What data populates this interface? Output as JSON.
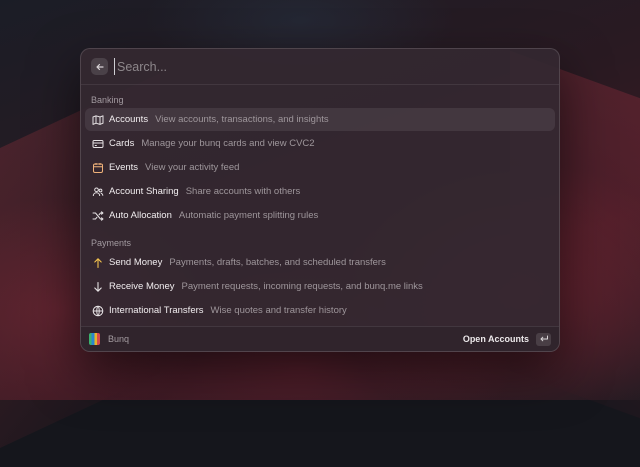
{
  "search": {
    "placeholder": "Search..."
  },
  "sections": [
    {
      "title": "Banking",
      "items": [
        {
          "label": "Accounts",
          "desc": "View accounts, transactions, and insights",
          "icon": "map-icon",
          "color": "#e6e2e4"
        },
        {
          "label": "Cards",
          "desc": "Manage your bunq cards and view CVC2",
          "icon": "card-icon",
          "color": "#e6e2e4"
        },
        {
          "label": "Events",
          "desc": "View your activity feed",
          "icon": "calendar-icon",
          "color": "#f0b27a"
        },
        {
          "label": "Account Sharing",
          "desc": "Share accounts with others",
          "icon": "users-icon",
          "color": "#e6e2e4"
        },
        {
          "label": "Auto Allocation",
          "desc": "Automatic payment splitting rules",
          "icon": "shuffle-icon",
          "color": "#e6e2e4"
        }
      ]
    },
    {
      "title": "Payments",
      "items": [
        {
          "label": "Send Money",
          "desc": "Payments, drafts, batches, and scheduled transfers",
          "icon": "arrow-up-icon",
          "color": "#f2c14e"
        },
        {
          "label": "Receive Money",
          "desc": "Payment requests, incoming requests, and bunq.me links",
          "icon": "arrow-down-icon",
          "color": "#e6e2e4"
        },
        {
          "label": "International Transfers",
          "desc": "Wise quotes and transfer history",
          "icon": "globe-icon",
          "color": "#e6e2e4"
        }
      ]
    }
  ],
  "footer": {
    "app_name": "Bunq",
    "action_label": "Open Accounts"
  }
}
